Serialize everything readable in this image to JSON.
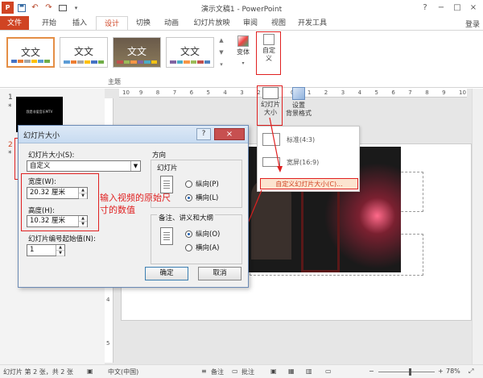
{
  "window": {
    "title": "演示文稿1 - PowerPoint",
    "login": "登录",
    "controls": [
      "?",
      "−",
      "□",
      "×"
    ]
  },
  "tabs": [
    "文件",
    "开始",
    "插入",
    "设计",
    "切换",
    "动画",
    "幻灯片放映",
    "审阅",
    "视图",
    "开发工具"
  ],
  "ribbon": {
    "theme_text": "文文",
    "theme_group_label": "主题",
    "variants_label": "变体",
    "custom_label": "自定\n义",
    "custom_label_line1": "自定",
    "custom_label_line2": "义",
    "slide_size_line1": "幻灯片",
    "slide_size_line2": "大小",
    "format_bg_line1": "设置",
    "format_bg_line2": "背景格式"
  },
  "slide_size_menu": {
    "items": [
      "标准(4:3)",
      "宽屏(16:9)",
      "自定义幻灯片大小(C)..."
    ]
  },
  "thumbs": {
    "slide1_num": "1",
    "slide1_text": "我是非爱音乐MTV",
    "slide2_num": "2"
  },
  "dialog": {
    "title": "幻灯片大小",
    "help": "?",
    "close": "×",
    "size_label": "幻灯片大小(S):",
    "size_value": "自定义",
    "width_label": "宽度(W):",
    "width_value": "20.32 厘米",
    "height_label": "高度(H):",
    "height_value": "10.32 厘米",
    "numbering_label": "幻灯片编号起始值(N):",
    "numbering_value": "1",
    "orientation_label": "方向",
    "slides_label": "幻灯片",
    "portrait_label": "纵向(P)",
    "landscape_label": "横向(L)",
    "notes_label": "备注、讲义和大纲",
    "notes_portrait_label": "纵向(O)",
    "notes_landscape_label": "横向(A)",
    "ok": "确定",
    "cancel": "取消"
  },
  "annotation": "输入视频的原始尺寸的数值",
  "ruler": {
    "h": [
      "10",
      "9",
      "8",
      "7",
      "6",
      "5",
      "4",
      "3",
      "2",
      "1",
      "0",
      "1",
      "2",
      "3",
      "4",
      "5",
      "6",
      "7",
      "8",
      "9",
      "10"
    ],
    "v": [
      "4",
      "5"
    ]
  },
  "status": {
    "slide": "幻灯片 第 2 张，共 2 张",
    "lang": "中文(中国)",
    "notes": "备注",
    "comments": "批注",
    "zoom": "78%"
  },
  "colors": {
    "accent": "#d04423",
    "annotation_red": "#e02020"
  }
}
